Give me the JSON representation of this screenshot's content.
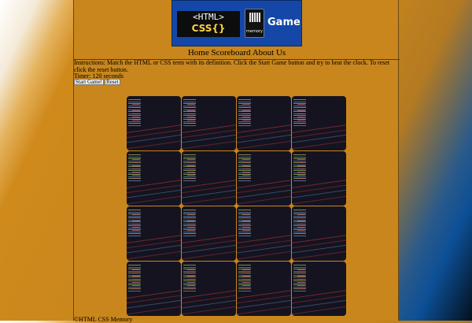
{
  "logo": {
    "code_line1": "<HTML>",
    "code_line2": "CSS{}",
    "card_text": "memory",
    "word": "Game"
  },
  "nav": {
    "home": "Home",
    "scoreboard": "Scoreboard",
    "about": "About Us"
  },
  "instructions": "Instructions: Match the HTML or CSS term with its definition. Click the Start Game button and try to beat the clock. To reset click the reset button.",
  "timer": "Timer: 120 seconds",
  "buttons": {
    "start": "Start Game!",
    "reset": "Reset"
  },
  "board": {
    "rows": 4,
    "columns": 4,
    "cards_face_down": 16
  },
  "footer": "©HTML CSS Memory"
}
